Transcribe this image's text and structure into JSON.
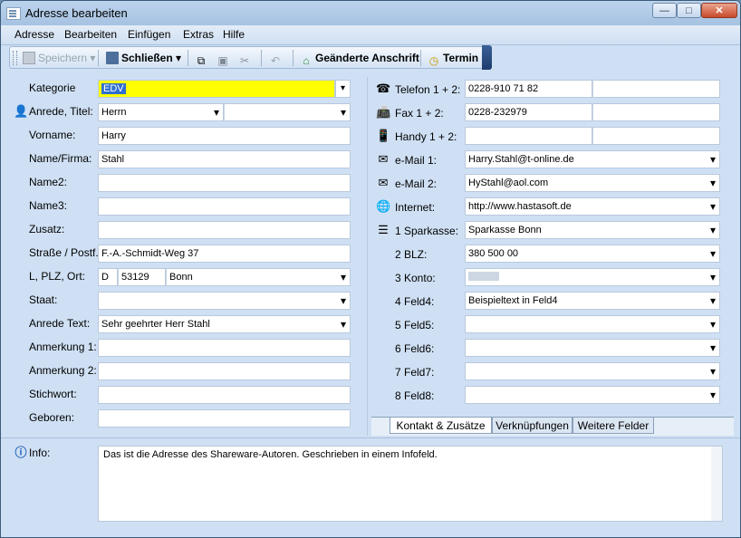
{
  "window": {
    "title": "Adresse bearbeiten",
    "minimize": "—",
    "maximize": "□",
    "close": "✕"
  },
  "menu": [
    "Adresse",
    "Bearbeiten",
    "Einfügen",
    "Extras",
    "Hilfe"
  ],
  "toolbar": {
    "save_label": "Speichern",
    "close_label": "Schließen",
    "changed_address_label": "Geänderte Anschrift",
    "appointment_label": "Termin"
  },
  "left": {
    "kategorie": {
      "label": "Kategorie",
      "value": "EDV"
    },
    "anrede_titel": {
      "label": "Anrede, Titel:",
      "anrede": "Herrn",
      "titel": ""
    },
    "vorname": {
      "label": "Vorname:",
      "value": "Harry"
    },
    "name_firma": {
      "label": "Name/Firma:",
      "value": "Stahl"
    },
    "name2": {
      "label": "Name2:",
      "value": ""
    },
    "name3": {
      "label": "Name3:",
      "value": ""
    },
    "zusatz": {
      "label": "Zusatz:",
      "value": ""
    },
    "strasse": {
      "label": "Straße / Postf.:",
      "value": "F.-A.-Schmidt-Weg 37"
    },
    "lpo": {
      "label": "L, PLZ, Ort:",
      "land": "D",
      "plz": "53129",
      "ort": "Bonn"
    },
    "staat": {
      "label": "Staat:",
      "value": ""
    },
    "anrede_text": {
      "label": "Anrede Text:",
      "value": "Sehr geehrter Herr Stahl"
    },
    "anmerkung1": {
      "label": "Anmerkung 1:",
      "value": ""
    },
    "anmerkung2": {
      "label": "Anmerkung 2:",
      "value": ""
    },
    "stichwort": {
      "label": "Stichwort:",
      "value": ""
    },
    "geboren": {
      "label": "Geboren:",
      "value": ""
    }
  },
  "right": {
    "telefon": {
      "label": "Telefon 1 + 2:",
      "value1": "0228-910 71 82",
      "value2": ""
    },
    "fax": {
      "label": "Fax 1 + 2:",
      "value1": "0228-232979",
      "value2": ""
    },
    "handy": {
      "label": "Handy 1 + 2:",
      "value1": "",
      "value2": ""
    },
    "email1": {
      "label": "e-Mail 1:",
      "value": "Harry.Stahl@t-online.de"
    },
    "email2": {
      "label": "e-Mail 2:",
      "value": "HyStahl@aol.com"
    },
    "internet": {
      "label": "Internet:",
      "value": "http://www.hastasoft.de"
    },
    "sparkasse": {
      "label": "1 Sparkasse:",
      "value": "Sparkasse Bonn"
    },
    "blz": {
      "label": "2 BLZ:",
      "value": "380 500 00"
    },
    "konto": {
      "label": "3 Konto:",
      "value": ""
    },
    "feld4": {
      "label": "4 Feld4:",
      "value": "Beispieltext in Feld4"
    },
    "feld5": {
      "label": "5 Feld5:",
      "value": ""
    },
    "feld6": {
      "label": "6 Feld6:",
      "value": ""
    },
    "feld7": {
      "label": "7 Feld7:",
      "value": ""
    },
    "feld8": {
      "label": "8 Feld8:",
      "value": ""
    }
  },
  "tabs": [
    "Kontakt & Zusätze",
    "Verknüpfungen",
    "Weitere Felder"
  ],
  "info": {
    "label": "Info:",
    "value": "Das ist die Adresse des Shareware-Autoren. Geschrieben in einem Infofeld."
  },
  "colors": {
    "highlight": "#ffff00",
    "accent": "#1f3c6d"
  }
}
